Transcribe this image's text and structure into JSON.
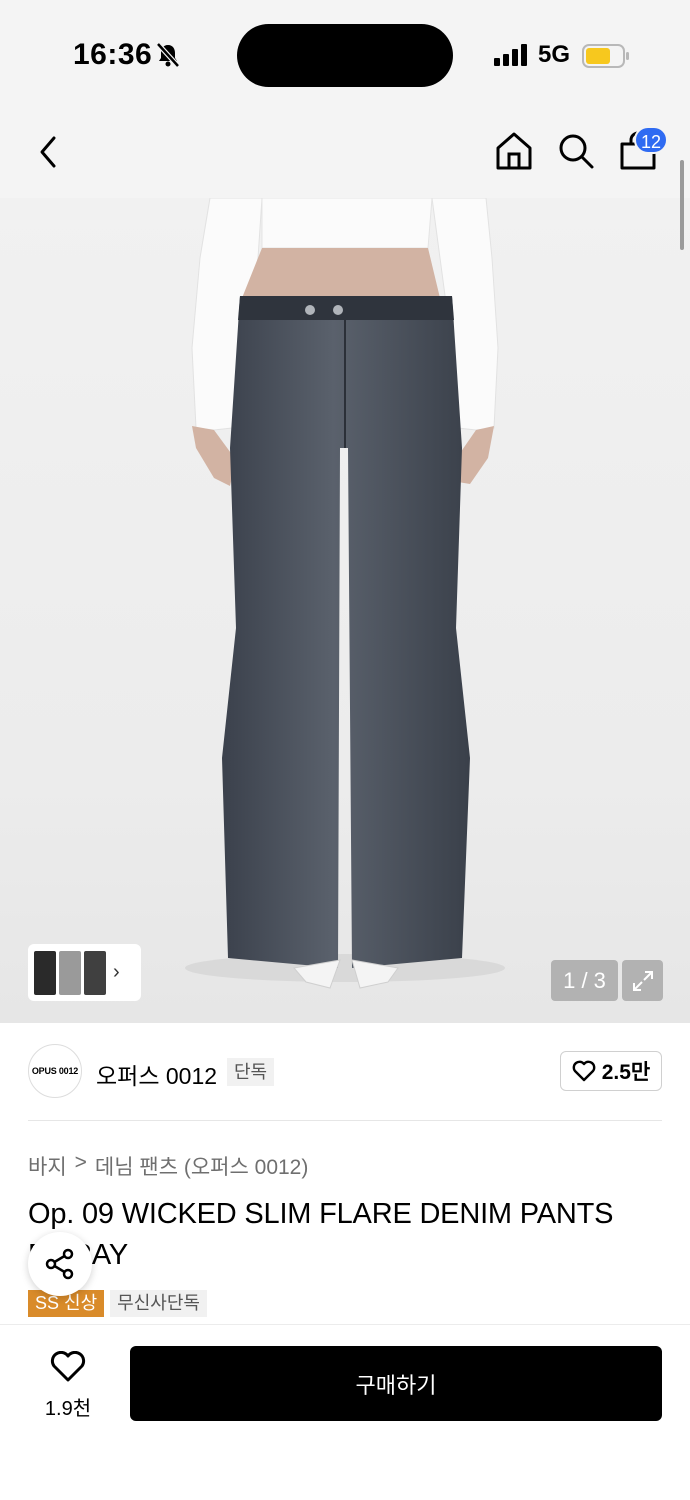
{
  "status": {
    "time": "16:36",
    "network": "5G"
  },
  "nav": {
    "cart_count": "12"
  },
  "gallery": {
    "counter": "1 / 3"
  },
  "brand": {
    "logo_text": "OPUS 0012",
    "name": "오퍼스 0012",
    "tag": "단독",
    "likes": "2.5만"
  },
  "breadcrumb": {
    "category": "바지",
    "separator": ">",
    "subcategory": "데님 팬츠 (오퍼스 0012)"
  },
  "product": {
    "title": "Op. 09 WICKED SLIM FLARE DENIM PANTS DGRAY",
    "tags": [
      "SS 신상",
      "무신사단독"
    ]
  },
  "bottom": {
    "wish_count": "1.9천",
    "buy_label": "구매하기"
  },
  "colors": {
    "accent_blue": "#2f6bf2",
    "tag_orange": "#d98b2a",
    "battery_yellow": "#f7c81e"
  }
}
